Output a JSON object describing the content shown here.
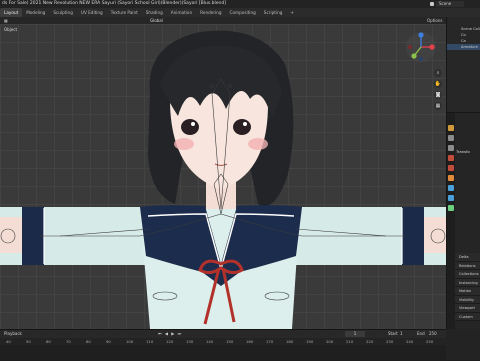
{
  "window": {
    "title": "ds For Sale) 2021 New Revolution NEW ERA Sayuri (Sayori School Girl)(Blender)(Sayori [Blus.blend]"
  },
  "scene": {
    "label": "Scene"
  },
  "workspace_tabs": [
    {
      "label": "Layout",
      "active": true
    },
    {
      "label": "Modeling"
    },
    {
      "label": "Sculpting"
    },
    {
      "label": "UV Editing"
    },
    {
      "label": "Texture Paint"
    },
    {
      "label": "Shading"
    },
    {
      "label": "Animation"
    },
    {
      "label": "Rendering"
    },
    {
      "label": "Compositing"
    },
    {
      "label": "Scripting"
    },
    {
      "label": "+"
    }
  ],
  "toolbar": {
    "global": "Global",
    "options": "Options"
  },
  "viewport": {
    "label": "Object"
  },
  "outliner": {
    "rows": [
      "Scene Collection",
      "Co",
      "Ca",
      "Armature"
    ]
  },
  "properties": {
    "header": "Transfo",
    "list": [
      "Delta",
      "Relations",
      "Collections",
      "Instancing",
      "Motion",
      "Visibility",
      "Viewport",
      "Custom"
    ]
  },
  "timeline": {
    "playback": "Playback",
    "current_frame": "1",
    "start_label": "Start",
    "start": "1",
    "end_label": "End",
    "end": "250",
    "ruler": [
      "40",
      "50",
      "60",
      "70",
      "80",
      "90",
      "100",
      "110",
      "120",
      "130",
      "140",
      "150",
      "160",
      "170",
      "180",
      "190",
      "200",
      "210",
      "220",
      "230",
      "240",
      "250"
    ]
  },
  "colors": {
    "accent": "#4772b3",
    "x_axis": "#e8414a",
    "y_axis": "#8bc34a",
    "z_axis": "#3d7fe0"
  }
}
